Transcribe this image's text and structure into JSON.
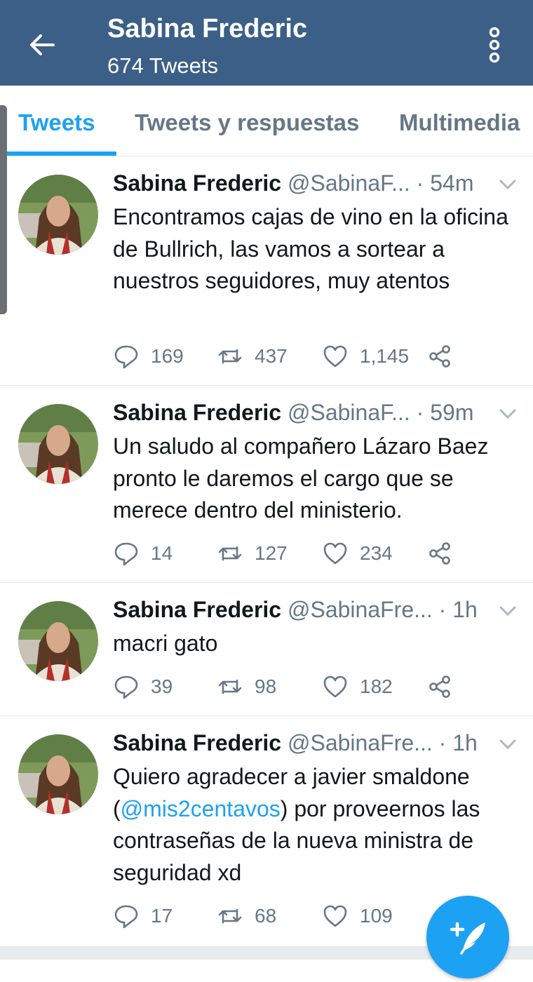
{
  "header": {
    "title": "Sabina Frederic",
    "subtitle": "674 Tweets"
  },
  "tabs": [
    "Tweets",
    "Tweets y respuestas",
    "Multimedia"
  ],
  "accent": "#1da1f2",
  "bar_color": "#3b5f86",
  "tweets": [
    {
      "name": "Sabina Frederic",
      "handle": "@SabinaF...",
      "time": "· 54m",
      "text": "Encontramos cajas de vino en la oficina de Bullrich, las vamos a sortear a nuestros seguidores, muy atentos",
      "replies": "169",
      "retweets": "437",
      "likes": "1,145"
    },
    {
      "name": "Sabina Frederic",
      "handle": "@SabinaF...",
      "time": "· 59m",
      "text": "Un saludo al compañero Lázaro Baez pronto le daremos el cargo que se merece dentro del ministerio.",
      "replies": "14",
      "retweets": "127",
      "likes": "234"
    },
    {
      "name": "Sabina Frederic",
      "handle": "@SabinaFre...",
      "time": "· 1h",
      "text": "macri gato",
      "replies": "39",
      "retweets": "98",
      "likes": "182"
    },
    {
      "name": "Sabina Frederic",
      "handle": "@SabinaFre...",
      "time": "· 1h",
      "text_before": "Quiero agradecer a javier smaldone (",
      "mention": "@mis2centavos",
      "text_after": ") por proveernos las contraseñas de la nueva ministra de seguridad xd",
      "replies": "17",
      "retweets": "68",
      "likes": "109"
    }
  ],
  "icons": {
    "back": "arrow-left-icon",
    "more": "more-vertical-icon",
    "reply": "reply-icon",
    "retweet": "retweet-icon",
    "like": "heart-icon",
    "share": "share-icon",
    "compose": "compose-tweet-icon"
  }
}
